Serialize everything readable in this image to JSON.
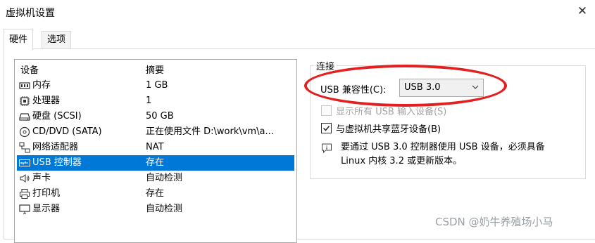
{
  "window": {
    "title": "虚拟机设置",
    "close_label": "✕"
  },
  "tabs": [
    {
      "label": "硬件"
    },
    {
      "label": "选项"
    }
  ],
  "device_list": {
    "header_device": "设备",
    "header_summary": "摘要",
    "rows": [
      {
        "name": "内存",
        "summary": "1 GB",
        "icon": "memory-icon"
      },
      {
        "name": "处理器",
        "summary": "1",
        "icon": "processor-icon"
      },
      {
        "name": "硬盘 (SCSI)",
        "summary": "50 GB",
        "icon": "hard-disk-icon"
      },
      {
        "name": "CD/DVD (SATA)",
        "summary": "正在使用文件 D:\\work\\vm\\a...",
        "icon": "cd-dvd-icon"
      },
      {
        "name": "网络适配器",
        "summary": "NAT",
        "icon": "network-adapter-icon"
      },
      {
        "name": "USB 控制器",
        "summary": "存在",
        "icon": "usb-icon",
        "selected": true
      },
      {
        "name": "声卡",
        "summary": "自动检测",
        "icon": "sound-card-icon"
      },
      {
        "name": "打印机",
        "summary": "存在",
        "icon": "printer-icon"
      },
      {
        "name": "显示器",
        "summary": "自动检测",
        "icon": "display-icon"
      }
    ]
  },
  "connection": {
    "legend": "连接",
    "usb_compat_label": "USB 兼容性(C):",
    "usb_compat_value": "USB 3.0",
    "show_all_usb": {
      "label": "显示所有 USB 输入设备(S)",
      "checked": false,
      "disabled": true
    },
    "share_bluetooth": {
      "label": "与虚拟机共享蓝牙设备(B)",
      "checked": true,
      "disabled": false
    },
    "info_line1": "要通过 USB 3.0 控制器使用 USB 设备，必须具备",
    "info_line2": "Linux 内核 3.2 或更新版本。"
  },
  "watermark": "CSDN @奶牛养殖场小马",
  "colors": {
    "selection": "#0078d7",
    "annotation_oval": "#e3201f"
  }
}
